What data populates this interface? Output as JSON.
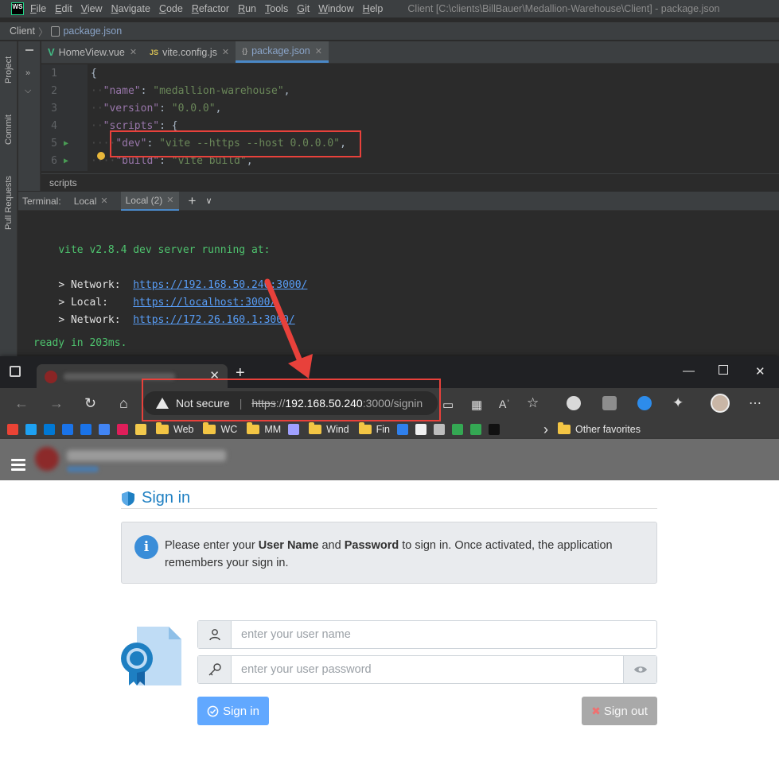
{
  "ide": {
    "logo": "WS",
    "menu": [
      {
        "u": "F",
        "rest": "ile"
      },
      {
        "u": "E",
        "rest": "dit"
      },
      {
        "u": "V",
        "rest": "iew"
      },
      {
        "u": "N",
        "rest": "avigate"
      },
      {
        "u": "C",
        "rest": "ode"
      },
      {
        "u": "R",
        "rest": "efactor"
      },
      {
        "u": "R",
        "rest": "un"
      },
      {
        "u": "T",
        "rest": "ools"
      },
      {
        "u": "G",
        "rest": "it"
      },
      {
        "u": "W",
        "rest": "indow"
      },
      {
        "u": "H",
        "rest": "elp"
      }
    ],
    "window_title": "Client [C:\\clients\\BillBauer\\Medallion-Warehouse\\Client] - package.json",
    "breadcrumb": {
      "root": "Client",
      "file": "package.json"
    },
    "left_tabs": [
      "Project",
      "Commit",
      "Pull Requests"
    ],
    "editor_tabs": [
      {
        "label": "HomeView.vue",
        "icon": "V",
        "icon_color": "#42b883",
        "active": false
      },
      {
        "label": "vite.config.js",
        "icon": "JS",
        "icon_color": "#d6bf55",
        "active": false
      },
      {
        "label": "package.json",
        "icon": "{}",
        "icon_color": "#9a9a9a",
        "active": true
      }
    ],
    "code_lines": [
      {
        "n": "1",
        "indent": "",
        "key": "",
        "val": "",
        "raw": "{",
        "run": false
      },
      {
        "n": "2",
        "indent": "··",
        "key": "\"name\"",
        "val": "\"medallion-warehouse\"",
        "tail": ",",
        "run": false
      },
      {
        "n": "3",
        "indent": "··",
        "key": "\"version\"",
        "val": "\"0.0.0\"",
        "tail": ",",
        "run": false
      },
      {
        "n": "4",
        "indent": "··",
        "key": "\"scripts\"",
        "val": "",
        "tail": "{",
        "run": false
      },
      {
        "n": "5",
        "indent": "····",
        "key": "\"dev\"",
        "val": "\"vite --https --host 0.0.0.0\"",
        "tail": ",",
        "run": true
      },
      {
        "n": "6",
        "indent": "····",
        "key": "\"build\"",
        "val": "\"vite build\"",
        "tail": ",",
        "run": true
      }
    ],
    "structure_crumb": "scripts",
    "terminal": {
      "label": "Terminal:",
      "tabs": [
        "Local",
        "Local (2)"
      ],
      "active_tab": "Local (2)",
      "lines": {
        "header_prefix": "vite v2.8.4 ",
        "header_rest": "dev server running at:",
        "net1_label": "> Network:  ",
        "net1_url": "https://192.168.50.240:3000/",
        "local_label": "> Local:    ",
        "local_url": "https://localhost:3000/",
        "net2_label": "> Network:  ",
        "net2_url": "https://172.26.160.1:3000/",
        "ready": "ready in 203ms."
      }
    }
  },
  "browser": {
    "address": {
      "warning": "Not secure",
      "scheme": "https",
      "sep": "://",
      "host": "192.168.50.240",
      "path": ":3000/signin"
    },
    "favorites": [
      {
        "type": "icon",
        "color": "#ea4335",
        "name": "gmail-icon"
      },
      {
        "type": "icon",
        "color": "#1da1f2",
        "name": "twitter-icon"
      },
      {
        "type": "icon",
        "color": "#0078d4",
        "name": "outlook-icon"
      },
      {
        "type": "icon",
        "color": "#1a73e8",
        "name": "calendar-icon"
      },
      {
        "type": "icon",
        "color": "#1a73e8",
        "name": "contacts-icon"
      },
      {
        "type": "icon",
        "color": "#4285f4",
        "name": "translate-icon"
      },
      {
        "type": "icon",
        "color": "#e01e5a",
        "name": "slack-icon"
      },
      {
        "type": "icon",
        "color": "#f2c94c",
        "name": "notes-icon"
      },
      {
        "type": "folder",
        "label": "Web"
      },
      {
        "type": "folder",
        "label": "WC"
      },
      {
        "type": "folder",
        "label": "MM"
      },
      {
        "type": "icon",
        "color": "#a0a0ff",
        "name": "site-icon"
      },
      {
        "type": "folder",
        "label": "Wind"
      },
      {
        "type": "folder",
        "label": "Fin"
      },
      {
        "type": "icon",
        "color": "#2f80ed",
        "name": "doc-icon"
      },
      {
        "type": "icon",
        "color": "#f0f0f0",
        "name": "github-icon"
      },
      {
        "type": "icon",
        "color": "#bdbdbd",
        "name": "sb-icon"
      },
      {
        "type": "icon",
        "color": "#34a853",
        "name": "td-icon"
      },
      {
        "type": "icon",
        "color": "#34a853",
        "name": "leaf-icon"
      },
      {
        "type": "icon",
        "color": "#111111",
        "name": "tradingview-icon"
      }
    ],
    "other_favorites": "Other favorites"
  },
  "app": {
    "signin_title": "Sign in",
    "info": {
      "t1": "Please enter your ",
      "b1": "User Name",
      "t2": " and ",
      "b2": "Password",
      "t3": " to sign in. Once activated, the application remembers your sign in."
    },
    "username_placeholder": "enter your user name",
    "password_placeholder": "enter your user password",
    "signin_button": "Sign in",
    "signout_button": "Sign out"
  }
}
